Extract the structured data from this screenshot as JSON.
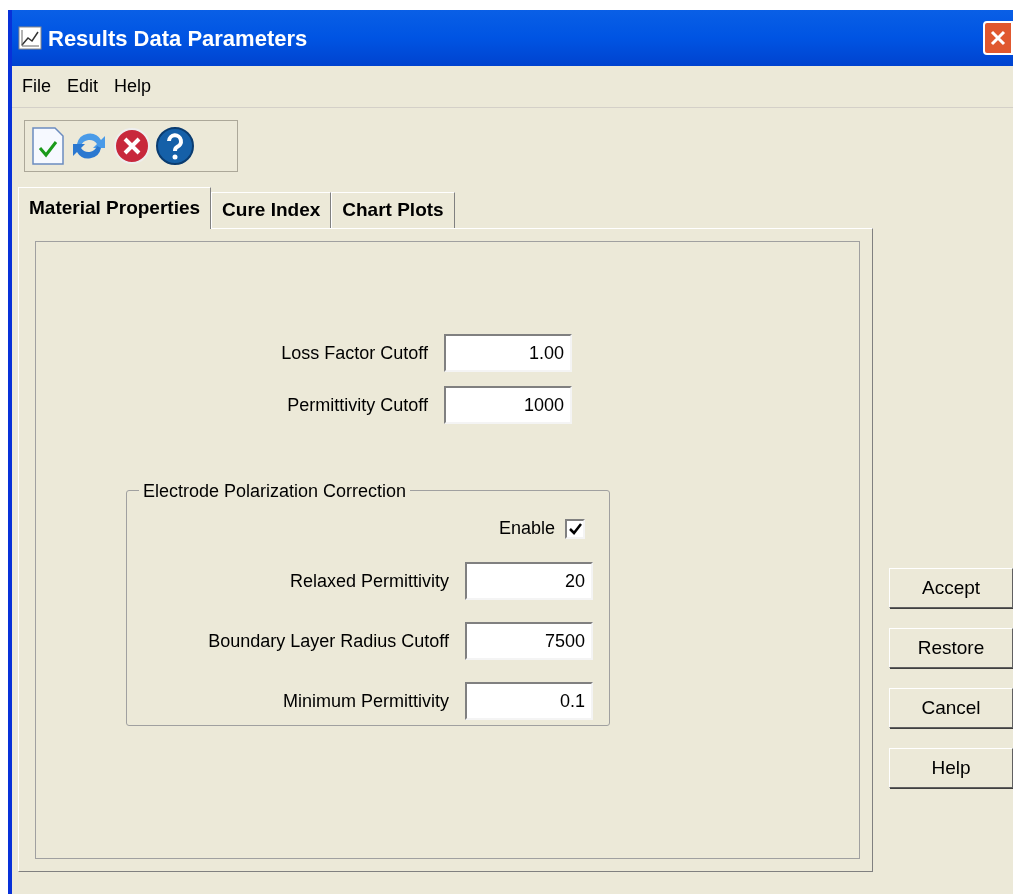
{
  "window": {
    "title": "Results Data Parameters"
  },
  "menu": [
    "File",
    "Edit",
    "Help"
  ],
  "tabs": [
    {
      "label": "Material Properties",
      "selected": true
    },
    {
      "label": "Cure Index",
      "selected": false
    },
    {
      "label": "Chart Plots",
      "selected": false
    }
  ],
  "fields": [
    {
      "label": "Loss Factor Cutoff",
      "value": "1.00"
    },
    {
      "label": "Permittivity Cutoff",
      "value": "1000"
    }
  ],
  "group": {
    "title": "Electrode Polarization Correction",
    "enable": {
      "label": "Enable",
      "checked": true
    },
    "fields": [
      {
        "label": "Relaxed Permittivity",
        "value": "20"
      },
      {
        "label": "Boundary Layer Radius Cutoff",
        "value": "7500"
      },
      {
        "label": "Minimum Permittivity",
        "value": "0.1"
      }
    ]
  },
  "buttons": [
    "Accept",
    "Restore",
    "Cancel",
    "Help"
  ]
}
